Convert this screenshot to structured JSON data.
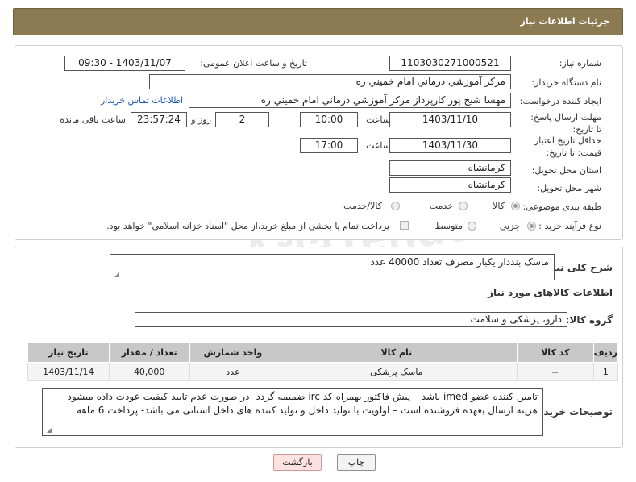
{
  "header": {
    "title": "جزئیات اطلاعات نیاز"
  },
  "form": {
    "need_number_label": "شماره نیاز:",
    "need_number": "1103030271000521",
    "announce_label": "تاریخ و ساعت اعلان عمومی:",
    "announce_value": "1403/11/07 - 09:30",
    "buyer_org_label": "نام دستگاه خریدار:",
    "buyer_org": "مرکز آموزشي درماني امام خميني ره",
    "creator_label": "ایجاد کننده درخواست:",
    "creator": "مهسا شیخ پور کارپرداز مرکز آموزشي درماني امام خميني ره",
    "contact_link": "اطلاعات تماس خریدار",
    "deadline_label": "مهلت ارسال پاسخ: تا تاریخ:",
    "deadline_date": "1403/11/10",
    "time_label": "ساعت",
    "deadline_time": "10:00",
    "days": "2",
    "days_label": "روز و",
    "remaining_time": "23:57:24",
    "remaining_label": "ساعت باقی مانده",
    "price_valid_label": "حداقل تاریخ اعتبار قیمت: تا تاریخ:",
    "price_valid_date": "1403/11/30",
    "price_valid_time": "17:00",
    "province_label": "استان محل تحویل:",
    "province": "کرمانشاه",
    "city_label": "شهر محل تحویل:",
    "city": "کرمانشاه",
    "category_label": "طبقه بندی موضوعی:",
    "category_options": [
      "کالا",
      "خدمت",
      "کالا/خدمت"
    ],
    "purchase_type_label": "نوع فرآیند خرید :",
    "purchase_options": [
      "جزیی",
      "متوسط"
    ],
    "treasury_note": "پرداخت تمام یا بخشی از مبلغ خرید،از محل \"اسناد خزانه اسلامی\" خواهد بود."
  },
  "details": {
    "general_desc_label": "شرح کلی نیاز:",
    "general_desc": "ماسک بنددار یکبار مصرف تعداد 40000 عدد",
    "goods_info_title": "اطلاعات کالاهای مورد نیاز",
    "goods_group_label": "گروه کالا:",
    "goods_group": "دارو، پزشکی و سلامت",
    "table_headers": [
      "ردیف",
      "کد کالا",
      "نام کالا",
      "واحد شمارش",
      "تعداد / مقدار",
      "تاریخ نیاز"
    ],
    "rows": [
      {
        "idx": "1",
        "code": "--",
        "name": "ماسک پزشکی",
        "unit": "عدد",
        "qty": "40,000",
        "date": "1403/11/14"
      }
    ],
    "buyer_notes_label": "توضیحات خریدار:",
    "buyer_notes": "تامین کننده عضو imed باشد – پیش فاکتور بهمراه کد irc ضمیمه گردد- در صورت عدم تایید کیفیت عودت داده میشود- هزینه ارسال بعهده فروشنده است – اولویت با تولید داخل و تولید کننده های داخل استانی می باشد- پرداخت 6 ماهه"
  },
  "buttons": {
    "print": "چاپ",
    "back": "بازگشت"
  },
  "watermark": "AriaTender.neT",
  "colors": {
    "header_bg": "#8c7a52",
    "link": "#1a55b0",
    "table_header": "#c8c8c8"
  }
}
